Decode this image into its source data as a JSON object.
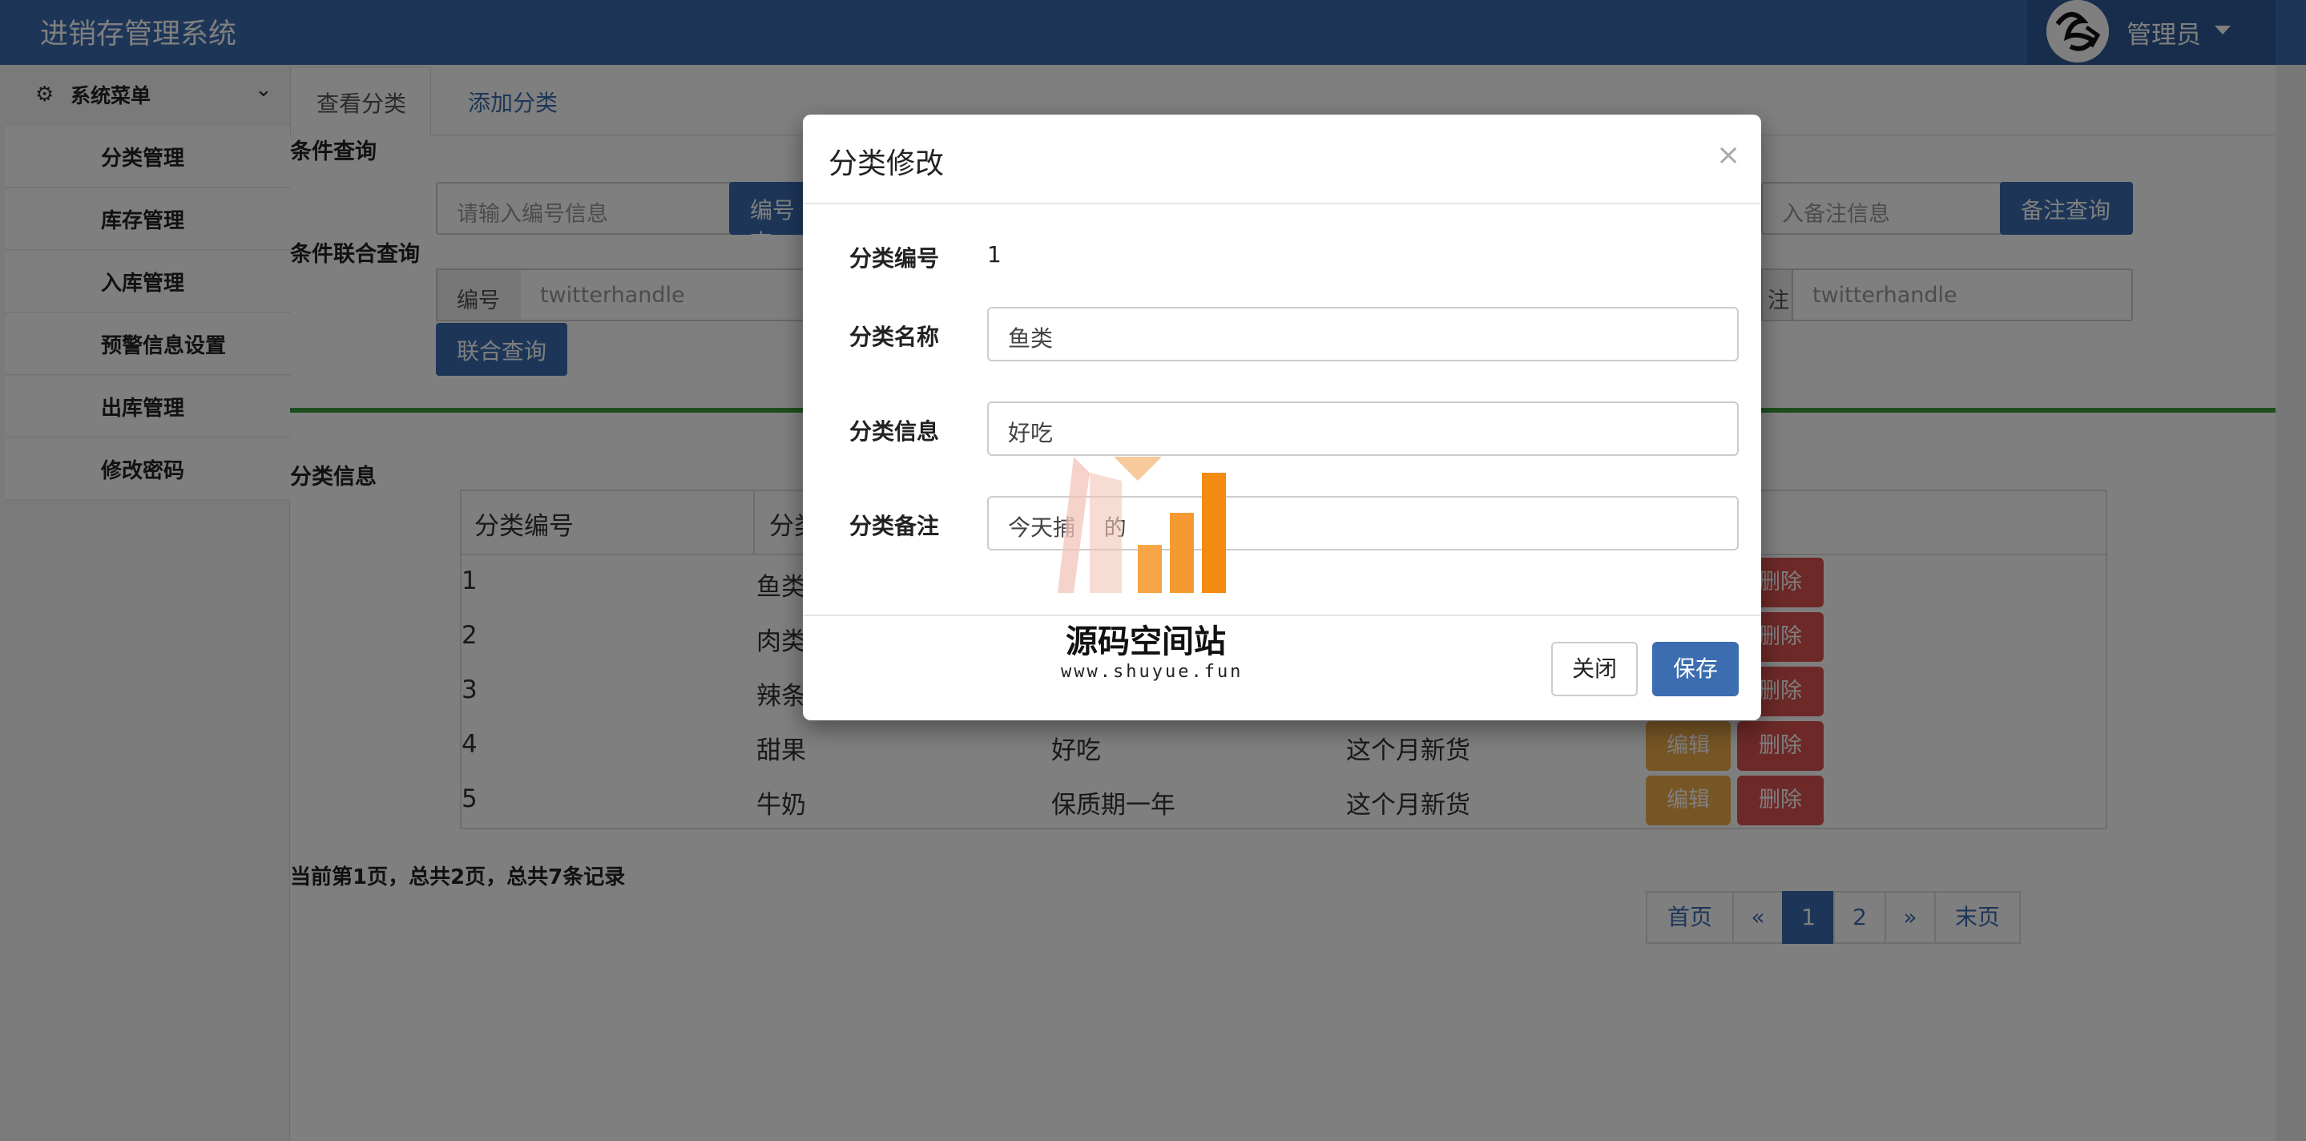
{
  "app": {
    "title": "进销存管理系统",
    "user": "管理员"
  },
  "sidebar": {
    "header": "系统菜单",
    "items": [
      {
        "label": "分类管理"
      },
      {
        "label": "库存管理"
      },
      {
        "label": "入库管理"
      },
      {
        "label": "预警信息设置"
      },
      {
        "label": "出库管理"
      },
      {
        "label": "修改密码"
      }
    ]
  },
  "tabs": [
    {
      "label": "查看分类"
    },
    {
      "label": "添加分类"
    }
  ],
  "search": {
    "section_label": "条件查询",
    "id_placeholder": "请输入编号信息",
    "id_button": "编号查",
    "note_placeholder": "入备注信息",
    "note_button": "备注查询",
    "joint_label": "条件联合查询",
    "joint_id_addon": "编号",
    "joint_id_placeholder": "twitterhandle",
    "joint_note_addon": "注",
    "joint_note_placeholder": "twitterhandle",
    "joint_button": "联合查询"
  },
  "table": {
    "section_label": "分类信息",
    "headers": [
      "分类编号",
      "分类"
    ],
    "rows": [
      {
        "id": "1",
        "name": "鱼类",
        "info": "",
        "note": ""
      },
      {
        "id": "2",
        "name": "肉类",
        "info": "",
        "note": ""
      },
      {
        "id": "3",
        "name": "辣条",
        "info": "",
        "note": ""
      },
      {
        "id": "4",
        "name": "甜果",
        "info": "好吃",
        "note": "这个月新货"
      },
      {
        "id": "5",
        "name": "牛奶",
        "info": "保质期一年",
        "note": "这个月新货"
      }
    ],
    "edit_label": "编辑",
    "delete_label": "删除"
  },
  "pagination": {
    "info": "当前第1页，总共2页，总共7条记录",
    "first": "首页",
    "prev": "«",
    "pages": [
      "1",
      "2"
    ],
    "current": "1",
    "next": "»",
    "last": "末页"
  },
  "modal": {
    "title": "分类修改",
    "close_glyph": "×",
    "id_label": "分类编号",
    "id_value": "1",
    "name_label": "分类名称",
    "name_value": "鱼类",
    "info_label": "分类信息",
    "info_value": "好吃",
    "note_label": "分类备注",
    "note_value": "今天捕    的",
    "close_button": "关闭",
    "save_button": "保存"
  },
  "watermark": {
    "text": "源码空间站",
    "url": "www.shuyue.fun"
  },
  "colors": {
    "primary": "#3b6db0",
    "warning": "#efad4d",
    "danger": "#d9534f",
    "success_line": "#3d9a3b"
  }
}
